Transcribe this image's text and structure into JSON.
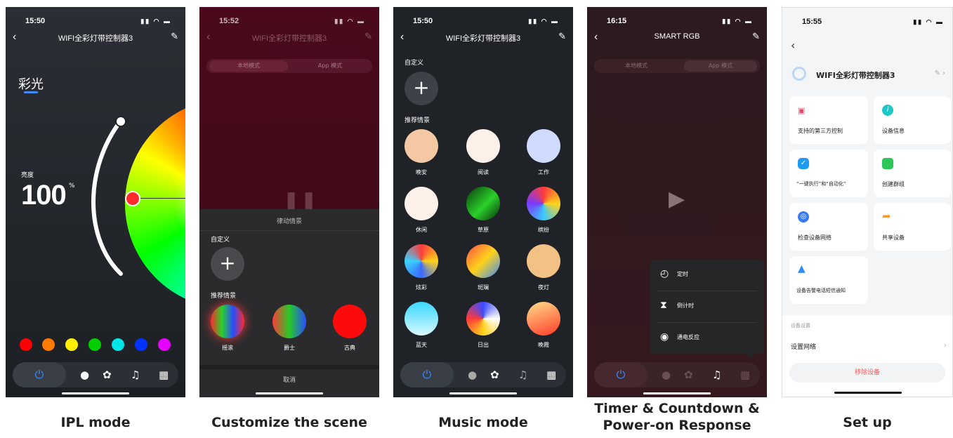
{
  "captions": [
    "IPL mode",
    "Customize the scene",
    "Music mode",
    "Timer & Countdown & Power-on Response",
    "Set up"
  ],
  "screen1": {
    "time": "15:50",
    "title": "WIFI全彩灯带控制器3",
    "mode_label": "彩光",
    "brightness_label": "亮度",
    "brightness_value": "100",
    "brightness_unit": "%",
    "swatches": [
      "#ff0000",
      "#ff7a00",
      "#ffee00",
      "#00d000",
      "#00e5e5",
      "#0033ff",
      "#e600ff"
    ]
  },
  "screen2": {
    "time": "15:52",
    "title": "WIFI全彩灯带控制器3",
    "tab_local": "本地模式",
    "tab_app": "App 模式",
    "sheet_title": "律动情景",
    "custom_label": "自定义",
    "recommend_label": "推荐情景",
    "scenes": [
      "摇滚",
      "爵士",
      "古典"
    ],
    "cancel": "取消"
  },
  "screen3": {
    "time": "15:50",
    "title": "WIFI全彩灯带控制器3",
    "custom_label": "自定义",
    "recommend_label": "推荐情景",
    "scenes": [
      "晚安",
      "阅读",
      "工作",
      "休闲",
      "草原",
      "缤纷",
      "炫彩",
      "斑斓",
      "夜灯",
      "蓝天",
      "日出",
      "晚霞"
    ]
  },
  "screen4": {
    "time": "16:15",
    "title": "SMART RGB",
    "tab_local": "本地模式",
    "tab_app": "App 模式",
    "menu": [
      "定时",
      "倒计时",
      "通电反应"
    ]
  },
  "screen5": {
    "time": "15:55",
    "device_name": "WIFI全彩灯带控制器3",
    "tiles": [
      "支持的第三方控制",
      "设备信息",
      "“一键执行”和“自动化”",
      "创建群组",
      "检查设备网络",
      "共享设备",
      "设备告警电话短信通知"
    ],
    "section_label": "设备设置",
    "network_row": "设置网络",
    "remove_button": "移除设备"
  },
  "colors": {
    "dark_bg": "#1f2226",
    "maroon": "#4a0a1c",
    "accent_blue": "#3d8bff",
    "remove_red": "#f05b5b"
  }
}
